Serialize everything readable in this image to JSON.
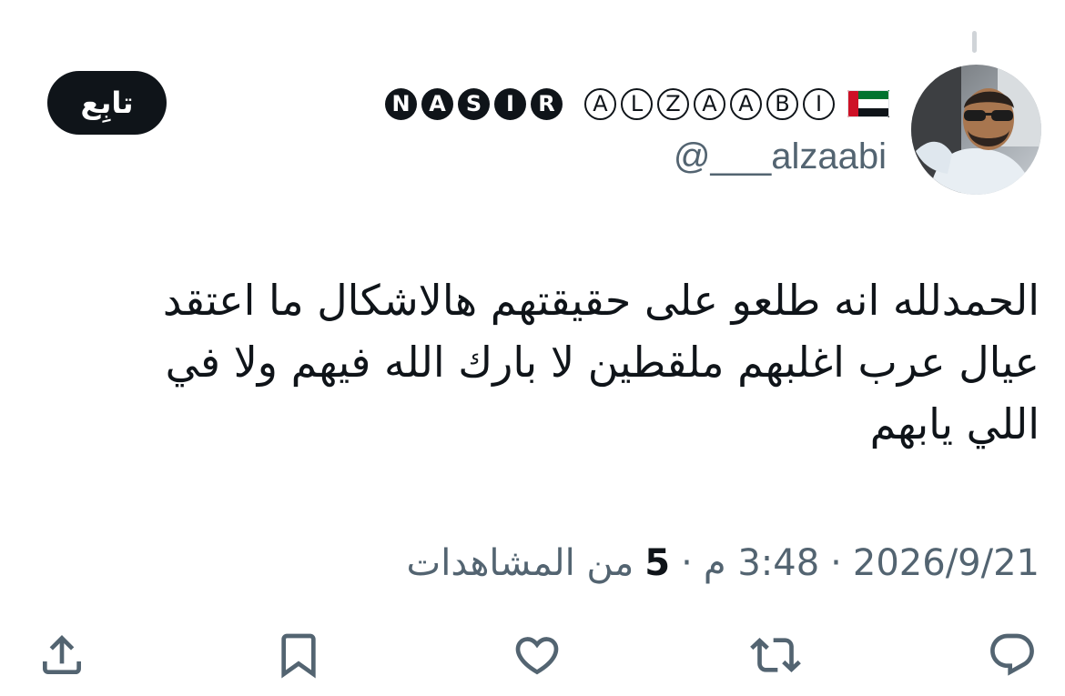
{
  "author": {
    "display_name_letters": [
      {
        "char": "N",
        "style": "filled"
      },
      {
        "char": "A",
        "style": "filled"
      },
      {
        "char": "S",
        "style": "filled"
      },
      {
        "char": "I",
        "style": "filled"
      },
      {
        "char": "R",
        "style": "filled"
      },
      {
        "char": "A",
        "style": "outline"
      },
      {
        "char": "L",
        "style": "outline"
      },
      {
        "char": "Z",
        "style": "outline"
      },
      {
        "char": "A",
        "style": "outline"
      },
      {
        "char": "A",
        "style": "outline"
      },
      {
        "char": "B",
        "style": "outline"
      },
      {
        "char": "I",
        "style": "outline"
      }
    ],
    "flag": "uae-flag-icon",
    "handle": "@___alzaabi"
  },
  "follow_button": {
    "label": "تابِع"
  },
  "tweet": {
    "lines": [
      "الحمدلله انه طلعو على حقيقتهم هالاشكال ما اعتقد",
      "عيال عرب اغلبهم ملقطين لا بارك الله فيهم ولا في",
      "اللي يابهم"
    ]
  },
  "meta": {
    "date": "2026/9/21",
    "time": "3:48 م",
    "separator": "·",
    "views_count": "5",
    "views_label": "من المشاهدات"
  },
  "actions": [
    {
      "name": "reply-icon"
    },
    {
      "name": "retweet-icon"
    },
    {
      "name": "like-icon"
    },
    {
      "name": "bookmark-icon"
    },
    {
      "name": "share-icon"
    }
  ],
  "colors": {
    "text_primary": "#0f1419",
    "text_secondary": "#536471",
    "button_bg": "#0f1419",
    "flag_red": "#ce1126",
    "flag_green": "#00732f"
  }
}
